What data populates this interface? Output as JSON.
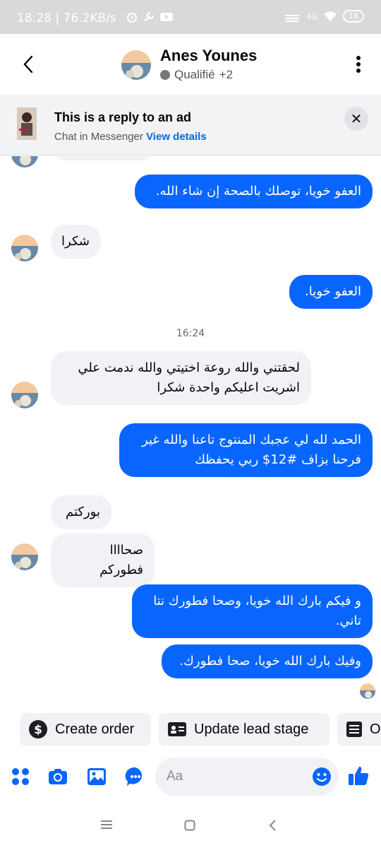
{
  "status_bar": {
    "time_speed": "18:28 | 76.2KB/s",
    "network": "4G",
    "battery": "16"
  },
  "header": {
    "contact_name": "Anes Younes",
    "status_label": "Qualifié",
    "extra_tags": "+2"
  },
  "ad_banner": {
    "title": "This is a reply to an ad",
    "subtitle": "Chat in Messenger",
    "link": "View details"
  },
  "messages": {
    "m1": "العفو خويا، توصلك بالصحة إن شاء الله.",
    "m2": "شكرا",
    "m3": "العفو خويا.",
    "time1": "16:24",
    "m4_l1": "لحقتني والله روعة اختيتي والله ندمت علي",
    "m4_l2": "اشريت اعليكم واحدة شكرا",
    "m5_l1": "الحمد لله لي عجبك المنتوج تاعنا والله غير",
    "m5_l2": "فرحنا بزاف #12$ ربي يحفظك",
    "m6": "بوركتم",
    "m7": "صحاااا فطوركم",
    "m8_l1": "و فيكم بارك الله خويا، وصحا فطورك نتا",
    "m8_l2": "تاني.",
    "m9": "وفيك بارك الله خويا، صحا فطورك."
  },
  "quick_actions": {
    "create_order": "Create order",
    "update_lead": "Update lead stage",
    "third_partial": "O"
  },
  "composer": {
    "placeholder": "Aa"
  },
  "colors": {
    "brand_blue": "#0866ff",
    "incoming_bg": "#f0f2f5"
  }
}
